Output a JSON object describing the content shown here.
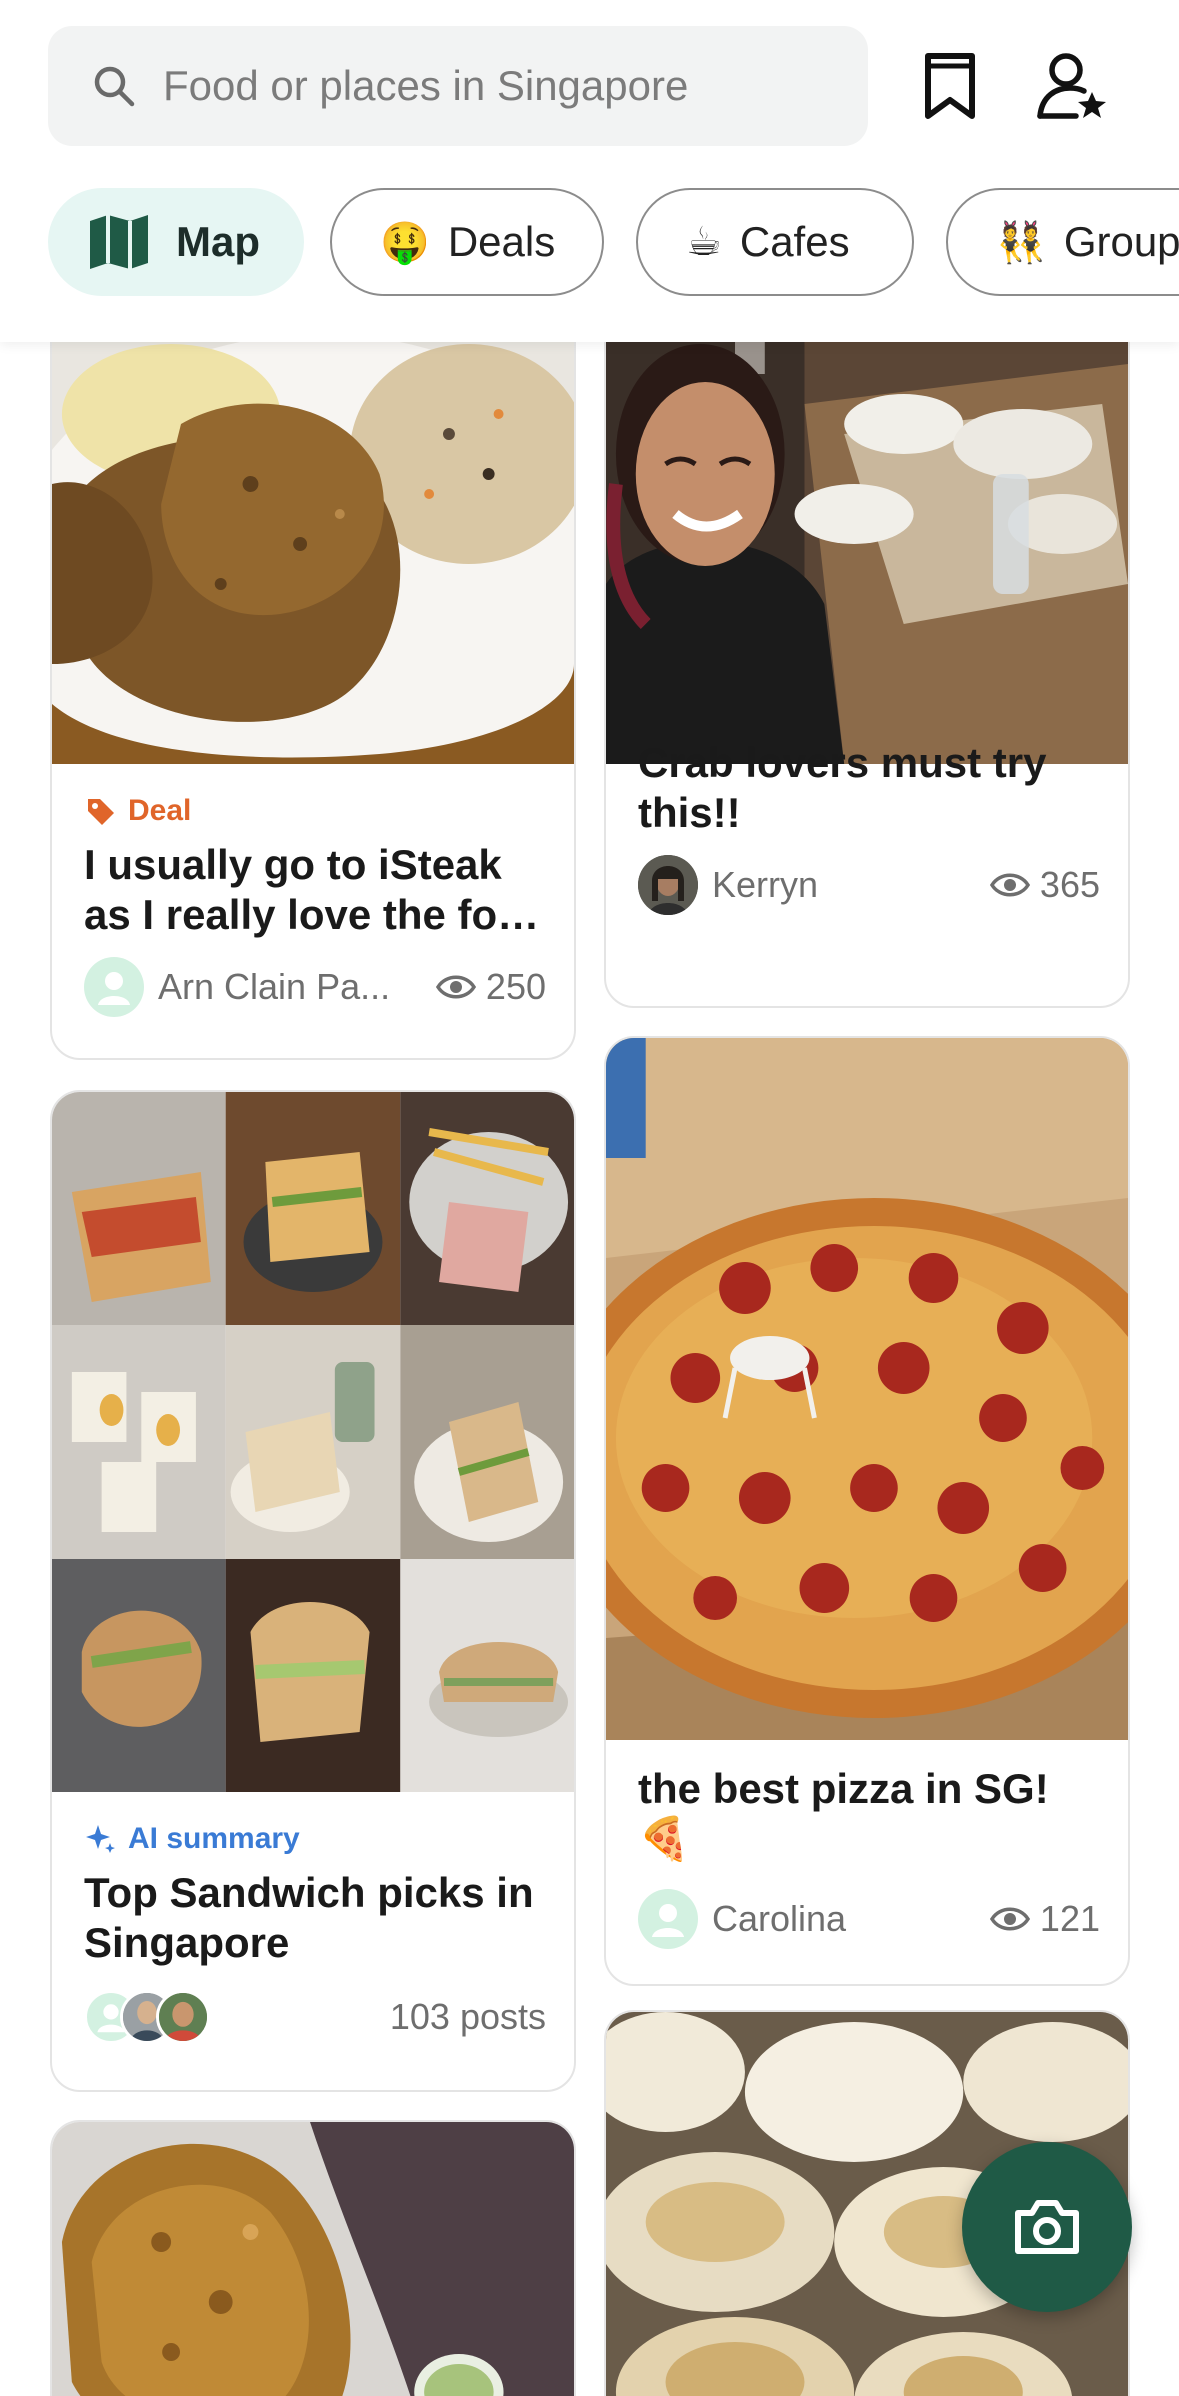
{
  "search": {
    "placeholder": "Food or places in Singapore"
  },
  "filters": [
    {
      "label": "Map",
      "icon": "map-icon"
    },
    {
      "label": "Deals",
      "emoji": "🤑"
    },
    {
      "label": "Cafes",
      "emoji": "☕"
    },
    {
      "label": "Group",
      "emoji": "👯"
    }
  ],
  "posts": [
    {
      "tag": "Deal",
      "title": "I usually go to iSteak as I really love the fo…",
      "author": "Arn Clain Pa...",
      "views": "250",
      "photo": "steak-with-rice"
    },
    {
      "title": "Crab lovers must try this!!",
      "author": "Kerryn",
      "views": "365",
      "photo": "selfie-at-restaurant"
    },
    {
      "tag": "AI summary",
      "title": "Top Sandwich picks in Singapore",
      "posts_count": "103 posts",
      "photo": "sandwich-collage"
    },
    {
      "title": "the best pizza in SG! 🍕",
      "author": "Carolina",
      "views": "121",
      "photo": "pepperoni-pizza"
    },
    {
      "photo": "fried-chicken"
    },
    {
      "photo": "cheese-tarts"
    }
  ],
  "colors": {
    "brand_green": "#1f5a46",
    "map_chip_bg": "#e6f6f3",
    "deal_orange": "#e0652a",
    "ai_blue": "#3a7bd5"
  },
  "fab": {
    "icon": "camera-icon"
  }
}
